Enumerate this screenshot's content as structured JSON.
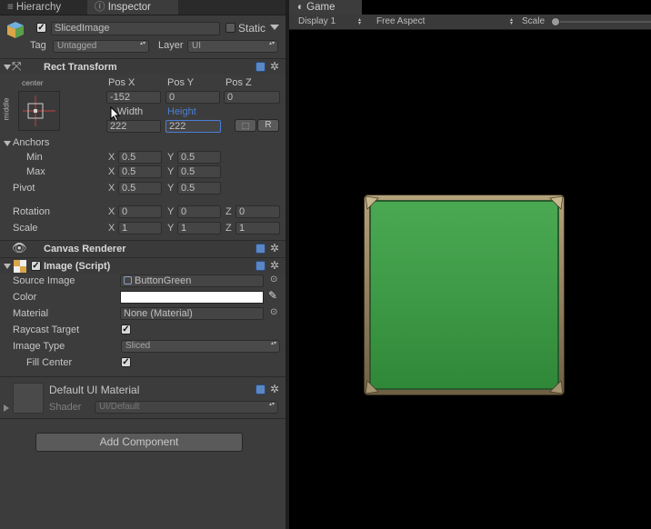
{
  "tabs": {
    "hierarchy": "Hierarchy",
    "inspector": "Inspector",
    "game": "Game"
  },
  "object": {
    "name": "SlicedImage",
    "static_label": "Static",
    "tag_label": "Tag",
    "tag_value": "Untagged",
    "layer_label": "Layer",
    "layer_value": "UI"
  },
  "rect_transform": {
    "title": "Rect Transform",
    "anchor_h": "center",
    "anchor_v": "middle",
    "posx_label": "Pos X",
    "posy_label": "Pos Y",
    "posz_label": "Pos Z",
    "posx": "-152",
    "posy": "0",
    "posz": "0",
    "width_label": "Width",
    "height_label": "Height",
    "width": "222",
    "height": "222",
    "blueprint_btn": "⬚",
    "raw_btn": "R",
    "anchors_label": "Anchors",
    "min_label": "Min",
    "max_label": "Max",
    "min_x": "0.5",
    "min_y": "0.5",
    "max_x": "0.5",
    "max_y": "0.5",
    "pivot_label": "Pivot",
    "pivot_x": "0.5",
    "pivot_y": "0.5",
    "rotation_label": "Rotation",
    "rot_x": "0",
    "rot_y": "0",
    "rot_z": "0",
    "scale_label": "Scale",
    "scale_x": "1",
    "scale_y": "1",
    "scale_z": "1",
    "x": "X",
    "y": "Y",
    "z": "Z"
  },
  "canvas_renderer": {
    "title": "Canvas Renderer"
  },
  "image": {
    "title": "Image (Script)",
    "source_label": "Source Image",
    "source_value": "ButtonGreen",
    "color_label": "Color",
    "color_value": "#ffffff",
    "material_label": "Material",
    "material_value": "None (Material)",
    "raycast_label": "Raycast Target",
    "raycast_checked": true,
    "type_label": "Image Type",
    "type_value": "Sliced",
    "fill_label": "Fill Center",
    "fill_checked": true
  },
  "material": {
    "title": "Default UI Material",
    "shader_label": "Shader",
    "shader_value": "UI/Default"
  },
  "add_component": "Add Component",
  "game": {
    "display": "Display 1",
    "aspect": "Free Aspect",
    "scale_label": "Scale"
  },
  "colors": {
    "button_green": "#3f9a46",
    "button_border": "#8a7a58",
    "highlight_blue": "#4a7fd6"
  }
}
